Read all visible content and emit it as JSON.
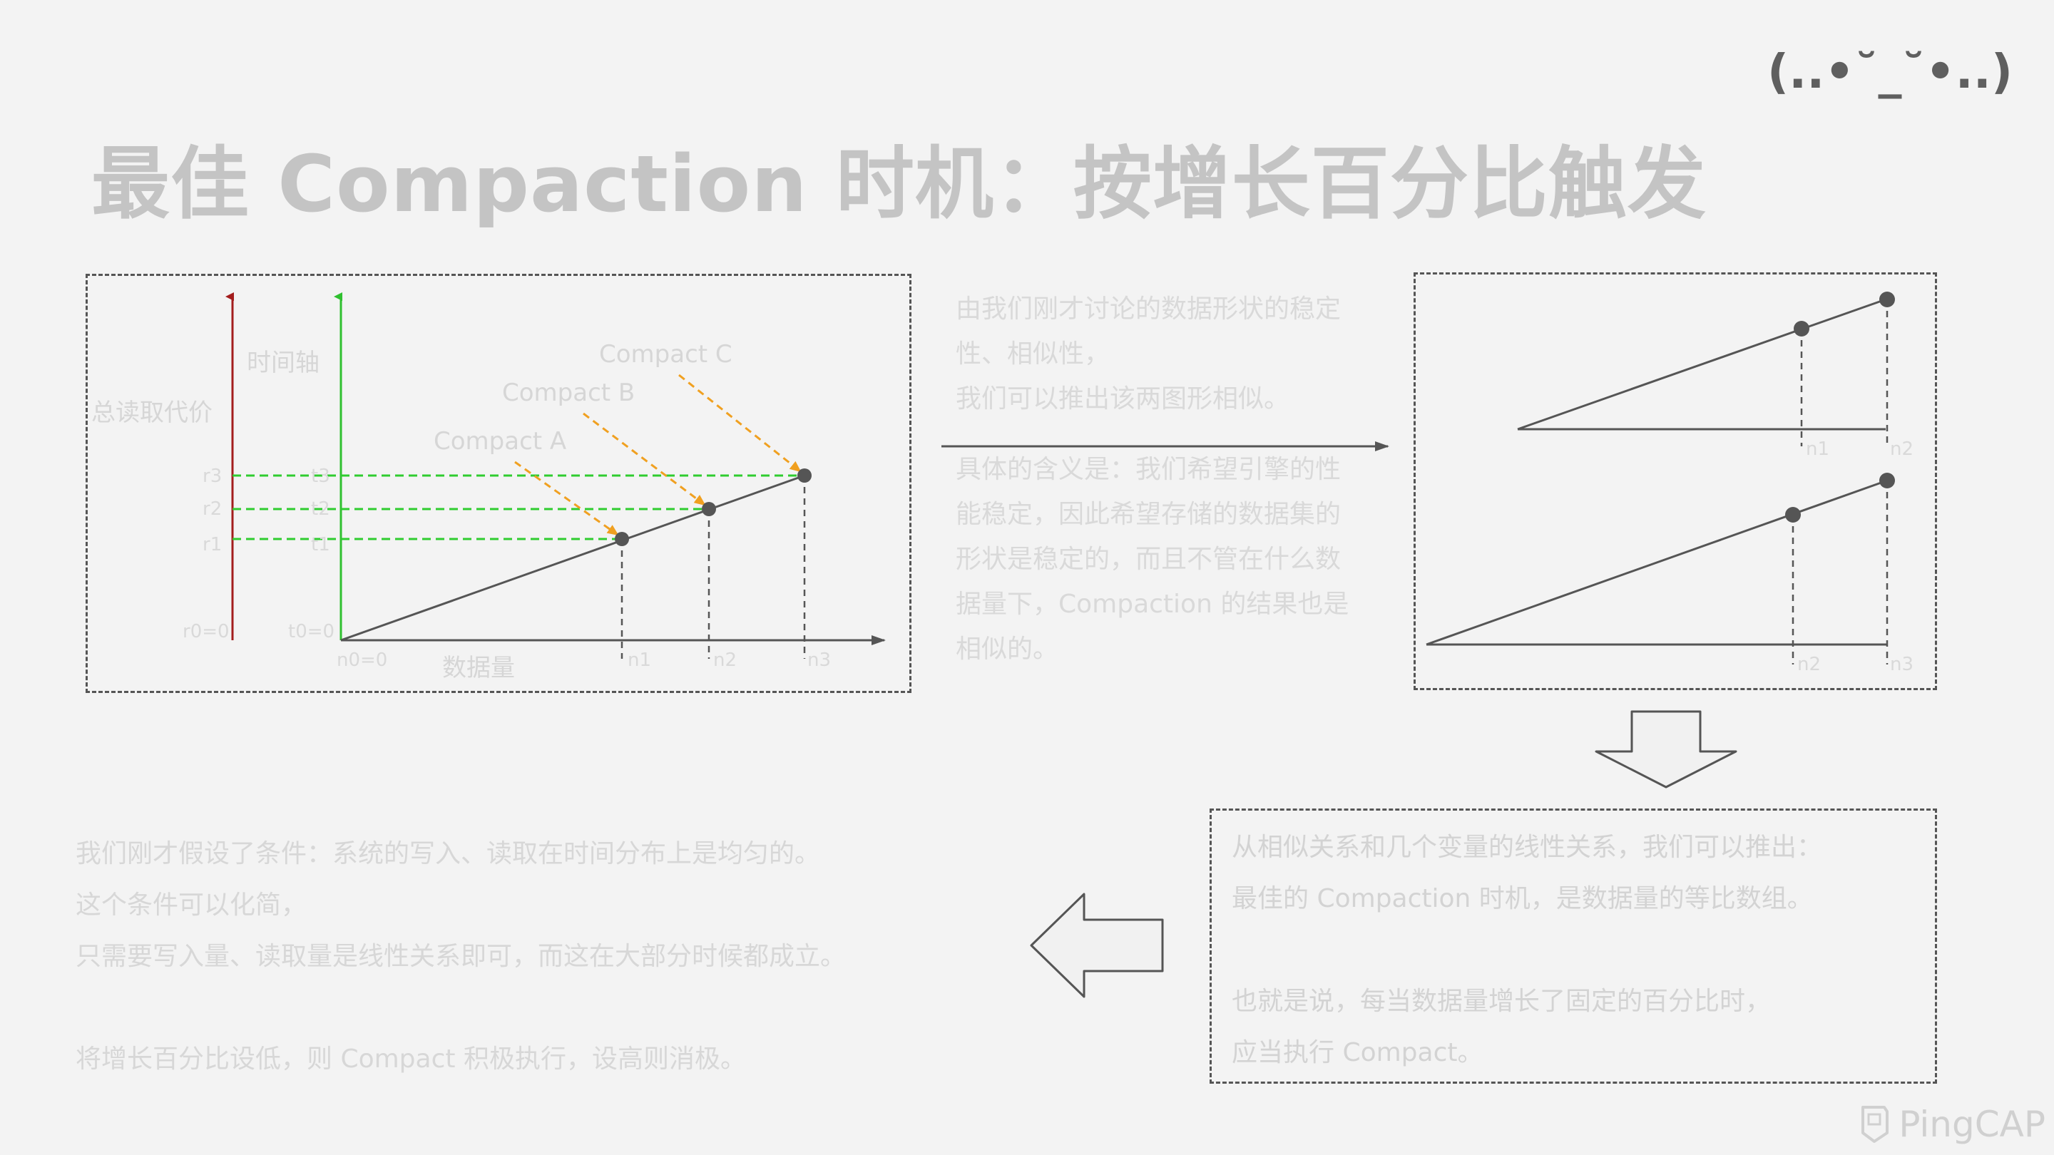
{
  "header": {
    "title": "最佳 Compaction 时机：按增长百分比触发",
    "emoticon": "(..•˘_˘•..)"
  },
  "left_diagram": {
    "cost_axis_label": "总读取代价",
    "time_axis_label": "时间轴",
    "x_axis_label": "数据量",
    "compact_labels": [
      "Compact A",
      "Compact B",
      "Compact C"
    ],
    "r_ticks": [
      "r3",
      "r2",
      "r1",
      "r0=0"
    ],
    "t_ticks": [
      "t3",
      "t2",
      "t1",
      "t0=0"
    ],
    "n_ticks": [
      "n0=0",
      "n1",
      "n2",
      "n3"
    ],
    "colors": {
      "cost_axis": "#a31d1d",
      "time_axis": "#2fc02f",
      "guide": "#2fcc2f",
      "compact_arrow": "#f0a020",
      "axis": "#555555"
    }
  },
  "middle_text": {
    "para1": "由我们刚才讨论的数据形状的稳定\n性、相似性，\n我们可以推出该两图形相似。",
    "para2": "具体的含义是：我们希望引擎的性\n能稳定，因此希望存储的数据集的\n形状是稳定的，而且不管在什么数\n据量下，Compaction 的结果也是\n相似的。"
  },
  "right_diagram": {
    "top_ticks": [
      "n1",
      "n2"
    ],
    "bottom_ticks": [
      "n2",
      "n3"
    ]
  },
  "conclusion_box": {
    "text": "从相似关系和几个变量的线性关系，我们可以推出：\n最佳的 Compaction 时机，是数据量的等比数组。\n\n也就是说，每当数据量增长了固定的百分比时，\n应当执行 Compact。"
  },
  "bottom_left_text": {
    "text": "我们刚才假设了条件：系统的写入、读取在时间分布上是均匀的。\n这个条件可以化简，\n只需要写入量、读取量是线性关系即可，而这在大部分时候都成立。\n\n将增长百分比设低，则 Compact 积极执行，设高则消极。"
  },
  "footer": {
    "logo": "PingCAP"
  }
}
